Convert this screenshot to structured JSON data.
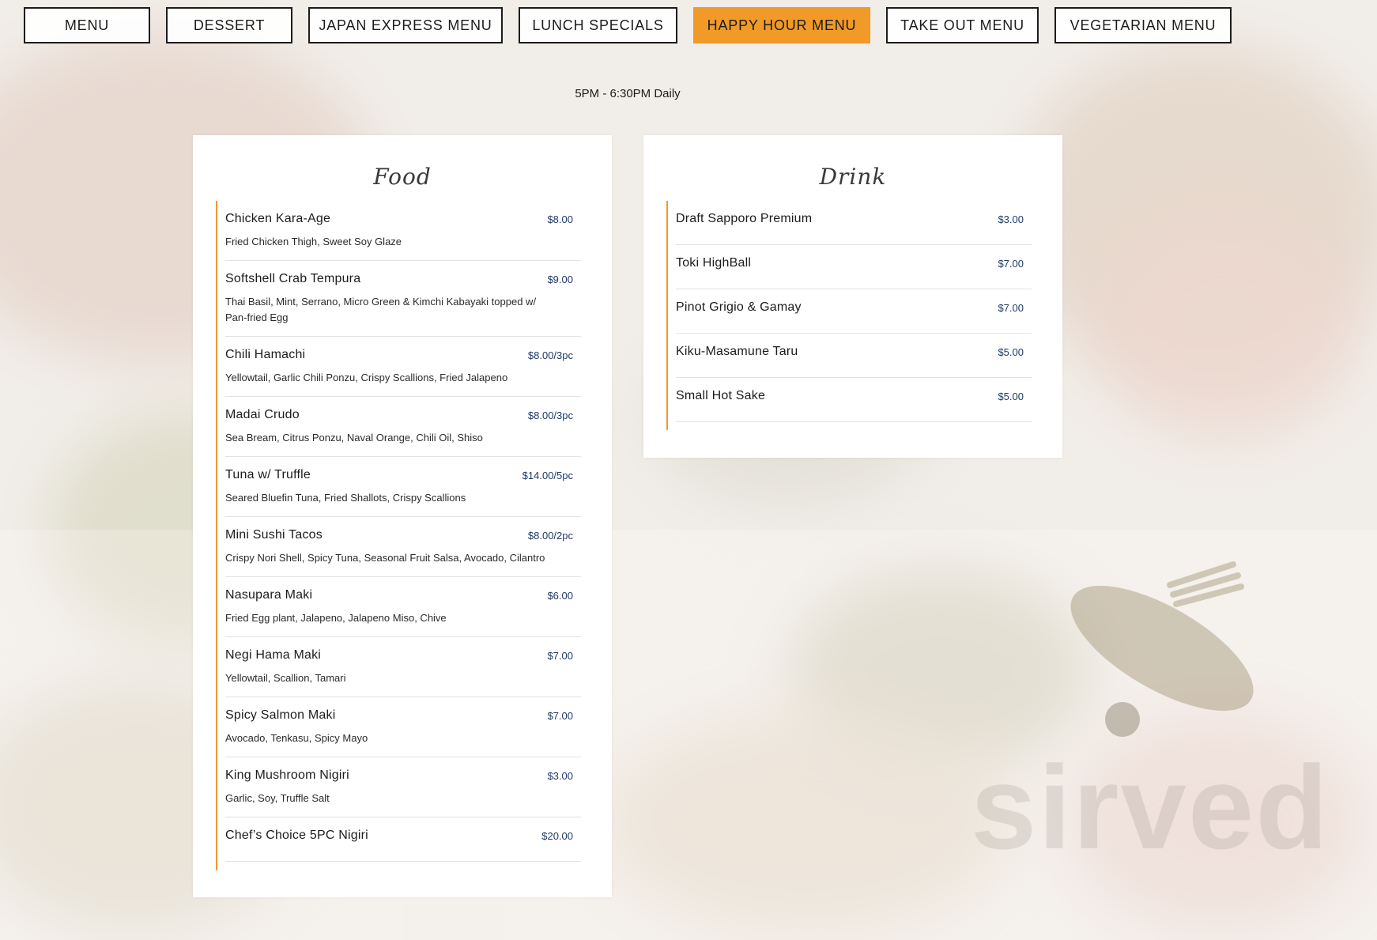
{
  "tabs": [
    {
      "label": "MENU",
      "active": false
    },
    {
      "label": "DESSERT",
      "active": false
    },
    {
      "label": "JAPAN EXPRESS MENU",
      "active": false
    },
    {
      "label": "LUNCH SPECIALS",
      "active": false
    },
    {
      "label": "HAPPY HOUR MENU",
      "active": true
    },
    {
      "label": "TAKE OUT MENU",
      "active": false
    },
    {
      "label": "VEGETARIAN MENU",
      "active": false
    }
  ],
  "hours": "5PM - 6:30PM Daily",
  "colors": {
    "accent": "#f19a28",
    "price": "#1f3a68"
  },
  "watermark": "sirved",
  "food": {
    "title": "Food",
    "items": [
      {
        "name": "Chicken Kara-Age",
        "price": "$8.00",
        "description": "Fried Chicken Thigh, Sweet Soy Glaze"
      },
      {
        "name": "Softshell Crab Tempura",
        "price": "$9.00",
        "description": "Thai Basil, Mint, Serrano, Micro Green & Kimchi Kabayaki topped w/ Pan-fried Egg"
      },
      {
        "name": "Chili Hamachi",
        "price": "$8.00/3pc",
        "description": "Yellowtail, Garlic Chili Ponzu, Crispy Scallions, Fried Jalapeno"
      },
      {
        "name": "Madai Crudo",
        "price": "$8.00/3pc",
        "description": "Sea Bream, Citrus Ponzu, Naval Orange, Chili Oil, Shiso"
      },
      {
        "name": "Tuna w/ Truffle",
        "price": "$14.00/5pc",
        "description": "Seared Bluefin Tuna, Fried Shallots, Crispy Scallions"
      },
      {
        "name": "Mini Sushi Tacos",
        "price": "$8.00/2pc",
        "description": "Crispy Nori Shell, Spicy Tuna, Seasonal Fruit Salsa, Avocado, Cilantro"
      },
      {
        "name": "Nasupara Maki",
        "price": "$6.00",
        "description": "Fried Egg plant, Jalapeno, Jalapeno Miso, Chive"
      },
      {
        "name": "Negi Hama Maki",
        "price": "$7.00",
        "description": "Yellowtail, Scallion, Tamari"
      },
      {
        "name": "Spicy Salmon Maki",
        "price": "$7.00",
        "description": "Avocado, Tenkasu, Spicy Mayo"
      },
      {
        "name": "King Mushroom Nigiri",
        "price": "$3.00",
        "description": "Garlic, Soy, Truffle Salt"
      },
      {
        "name": "Chef’s Choice 5PC Nigiri",
        "price": "$20.00",
        "description": ""
      }
    ]
  },
  "drink": {
    "title": "Drink",
    "items": [
      {
        "name": "Draft Sapporo Premium",
        "price": "$3.00"
      },
      {
        "name": "Toki HighBall",
        "price": "$7.00"
      },
      {
        "name": "Pinot Grigio & Gamay",
        "price": "$7.00"
      },
      {
        "name": "Kiku-Masamune Taru",
        "price": "$5.00"
      },
      {
        "name": "Small Hot Sake",
        "price": "$5.00"
      }
    ]
  }
}
